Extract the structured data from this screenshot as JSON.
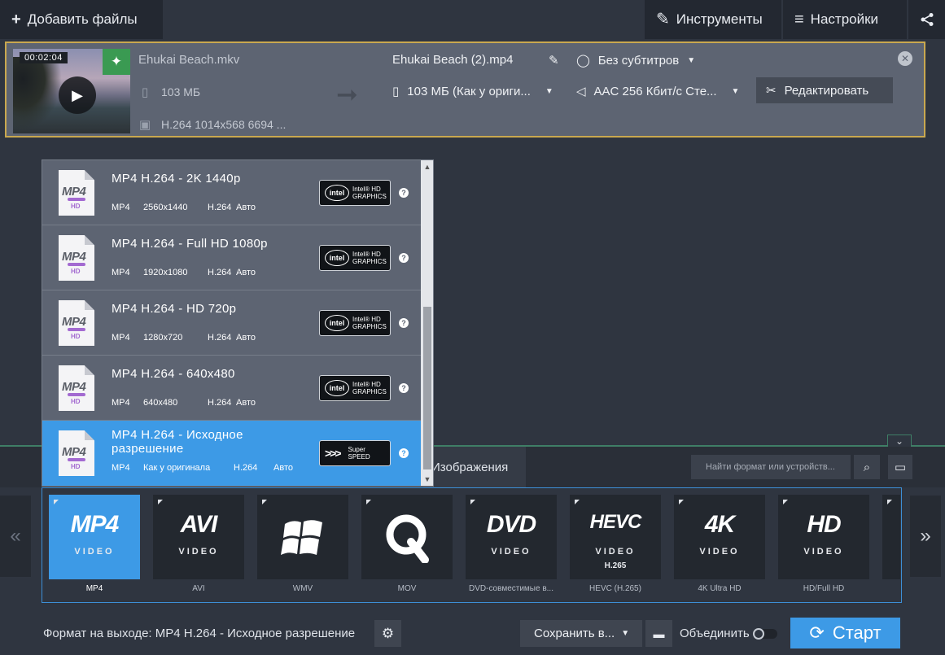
{
  "toolbar": {
    "add_files": "Добавить файлы",
    "tools": "Инструменты",
    "settings": "Настройки"
  },
  "file": {
    "duration": "00:02:04",
    "source_name": "Ehukai Beach.mkv",
    "source_size": "103 МБ",
    "source_codec": "H.264 1014x568 6694 ...",
    "output_name": "Ehukai Beach (2).mp4",
    "output_size": "103 МБ (Как у ориги...",
    "subtitles": "Без субтитров",
    "audio": "AAC 256 Кбит/с Сте...",
    "edit_label": "Редактировать"
  },
  "presets": [
    {
      "title": "MP4 H.264 - 2K 1440p",
      "format": "MP4",
      "resolution": "2560x1440",
      "codec": "H.264",
      "mode": "Авто",
      "badge": "intel"
    },
    {
      "title": "MP4 H.264 - Full HD 1080p",
      "format": "MP4",
      "resolution": "1920x1080",
      "codec": "H.264",
      "mode": "Авто",
      "badge": "intel"
    },
    {
      "title": "MP4 H.264 - HD 720p",
      "format": "MP4",
      "resolution": "1280x720",
      "codec": "H.264",
      "mode": "Авто",
      "badge": "intel"
    },
    {
      "title": "MP4 H.264 - 640x480",
      "format": "MP4",
      "resolution": "640x480",
      "codec": "H.264",
      "mode": "Авто",
      "badge": "intel"
    },
    {
      "title": "MP4 H.264 - Исходное разрешение",
      "format": "MP4",
      "resolution": "Как у оригинала",
      "codec": "H.264",
      "mode": "Авто",
      "badge": "superspeed",
      "selected": true
    }
  ],
  "badges": {
    "intel_word": "intel",
    "intel_line1": "Intel® HD",
    "intel_line2": "GRAPHICS",
    "super_line1": "Super",
    "super_line2": "SPEED"
  },
  "doc_icon": {
    "text": "MP4",
    "hd": "HD"
  },
  "bottom": {
    "images_tab": "Изображения",
    "search_placeholder": "Найти формат или устройств..."
  },
  "formats": [
    {
      "logo": "MP4",
      "sub": "VIDEO",
      "label": "MP4",
      "selected": true
    },
    {
      "logo": "AVI",
      "sub": "VIDEO",
      "label": "AVI"
    },
    {
      "logo": "",
      "sub": "",
      "label": "WMV",
      "icon": "windows-logo-icon"
    },
    {
      "logo": "",
      "sub": "",
      "label": "MOV",
      "icon": "quicktime-logo-icon"
    },
    {
      "logo": "DVD",
      "sub": "VIDEO",
      "label": "DVD-совместимые в..."
    },
    {
      "logo": "HEVC",
      "sub": "VIDEO",
      "extra": "H.265",
      "label": "HEVC (H.265)"
    },
    {
      "logo": "4K",
      "sub": "VIDEO",
      "label": "4K Ultra HD"
    },
    {
      "logo": "HD",
      "sub": "VIDEO",
      "label": "HD/Full HD"
    }
  ],
  "footer": {
    "output_format": "Формат на выходе: MP4 H.264 - Исходное разрешение",
    "save_to": "Сохранить в...",
    "merge": "Объединить",
    "start": "Старт"
  },
  "colors": {
    "accent": "#3d9ae6",
    "item_border": "#c9a84f",
    "bg": "#2f3540"
  }
}
